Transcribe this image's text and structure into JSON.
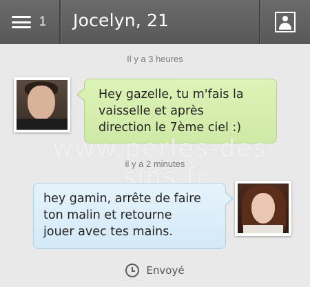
{
  "header": {
    "menu_icon": "hamburger-menu-icon",
    "menu_count": "1",
    "title": "Jocelyn, 21",
    "profile_icon": "profile-icon"
  },
  "conversation": {
    "messages": [
      {
        "timestamp": "Il y a 3 heures",
        "direction": "incoming",
        "bubble_color": "#d6efb0",
        "lines": [
          "Hey gazelle, tu m'fais la",
          "vaisselle et après",
          "direction le 7ème ciel :)"
        ]
      },
      {
        "timestamp": "il y a 2 minutes",
        "direction": "outgoing",
        "bubble_color": "#dcedf8",
        "lines": [
          "hey gamin, arrête de faire",
          "ton malin et retourne",
          "jouer avec tes mains."
        ]
      }
    ]
  },
  "watermark": "www.perles-des-sms.fr",
  "status": {
    "icon": "clock-icon",
    "label": "Envoyé"
  }
}
